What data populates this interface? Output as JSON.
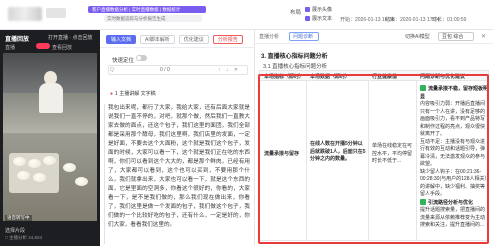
{
  "topbar": {
    "banner": "客户直播数据分析 | 实时直播数据 | 数据统计",
    "banner_sub": "实时数据追踪与分析报告生成",
    "layout_label": "布局",
    "options": [
      "展示头像",
      "展示文本"
    ],
    "time1": "开始：2026-01-13 16:35",
    "time2": "结束：2026-01-13 17:34",
    "time3": "时长：01:00:59"
  },
  "left": {
    "title": "直播回放",
    "sub": "打开直播 · 点击回放",
    "row_a": "直播",
    "row_b": "查看回放",
    "badge": "语音转写中",
    "bottom": "选择片段",
    "bottom2": "□ 主播分析 24,824"
  },
  "middle": {
    "tabs": [
      "输入文档",
      "AI脚本解析",
      "优化建议",
      "分析报告"
    ],
    "locate_label": "快速定位",
    "search_placeholder": "Q",
    "pager": "0 / 0",
    "nav_icons": "↑ ↓ ✕",
    "comment_header": "1 主播讲解 文字稿",
    "transcript": "我包出来呢，都行了大家，我给大家，还有后面大家就是说我们一直不停的，对吧，就那个做，然后我们一直教大家去做的面点，还这个包子，我们这里的面团，我们全部都是采用那个酵母，我们这里啊，我们店里的发面，一定是好面，不要去这个大面粉，这个就是我们这个包子，发面的时候，大家可以看一下，这个就是我们正在吃的东西啊，你们可以看到这个大大的，都是那个鲜肉，已经有用了，大家都可以看到，这个也可以买到，不要用那个什么，我们就拿出来，大家也可以看一下，就是这个东西的面，它是里面的空洞多，你看这个很好的，你看的，大家看一下，是不是我们做的，那么我们现在做出来，你看了，我们这里是做一个发面的包子，我们做这个包子，我们做的一个比较好吃的包子，还有什么，一定是好的，你们大家，看看我们这里的。"
  },
  "right": {
    "tab": "直播分析",
    "select": "问题诊断",
    "title_right": "切换AI模型",
    "select2": "豆包 综合",
    "section": "3. 直播核心指标问题分析",
    "sub": "3.1 直播核心指标问题分析",
    "headers": [
      "本场指标（即时）",
      "本场数据（即时）",
      "行业健康值",
      "问题诊断与优化建议"
    ],
    "row": {
      "metric": "流量承接与留存",
      "data": "在线人数在开播5分钟以后就跌破1人，后面只在5分钟之内的数量。",
      "health": "单场在线稳定在可控水平，平均停留时长不低于...",
      "advice_title": "流量承接不稳，留存短板明显",
      "advice_1": "内容吸引力弱：开播后直播间只有一个人在讲，没有足够的画面吸引力，看不到产品特写和制作过程的亮点，观众很快就离开了。",
      "advice_2": "互动不足：主播没有与观众进行有效的互动和话题引导，弹幕冷清，无法激发观众的参与欲望。",
      "advice_3": "缺少留人钩子：在00:21:36-00:28:30(与用户的128人相关）的讲解中，缺少福利、抽奖等留人手段。",
      "advice_title2": "引流路径分析与优化",
      "advice_4": "提升话题搜索量，把直播间的流量来源从依赖推荐变为主动搜索和关注，提升直播间的..."
    }
  },
  "colors": {
    "accent": "#5b6cf0",
    "highlight": "#ea3b3b",
    "check": "#2fb45a",
    "banner": "#7b5cf0"
  }
}
